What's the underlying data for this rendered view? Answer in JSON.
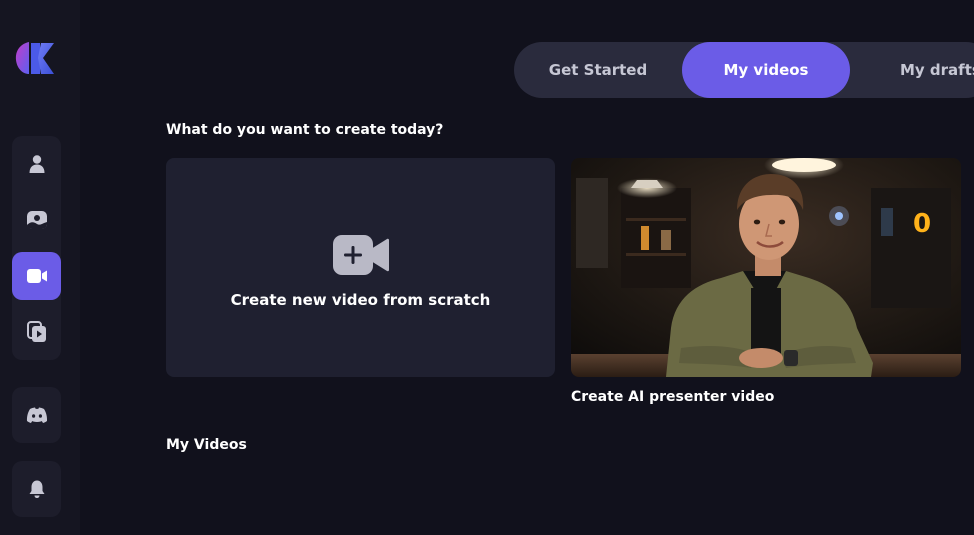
{
  "tabs": [
    {
      "label": "Get Started"
    },
    {
      "label": "My videos"
    },
    {
      "label": "My drafts"
    }
  ],
  "active_tab": "My videos",
  "create_section": {
    "heading": "What do you want to create today?",
    "new_video_label": "Create new video from scratch",
    "ai_presenter_label": "Create AI presenter video"
  },
  "my_videos": {
    "heading": "My Videos"
  },
  "sidebar": {
    "items": [
      {
        "icon": "user-icon",
        "active": false
      },
      {
        "icon": "image-icon",
        "active": false
      },
      {
        "icon": "video-camera-icon",
        "active": true
      },
      {
        "icon": "video-library-icon",
        "active": false
      },
      {
        "icon": "discord-icon",
        "active": false
      },
      {
        "icon": "bell-icon",
        "active": false
      }
    ]
  },
  "colors": {
    "background": "#11111c",
    "sidebar": "#151521",
    "accent": "#6b5ce7",
    "card": "#1f2030",
    "tab_bar": "#2a2b3d"
  }
}
